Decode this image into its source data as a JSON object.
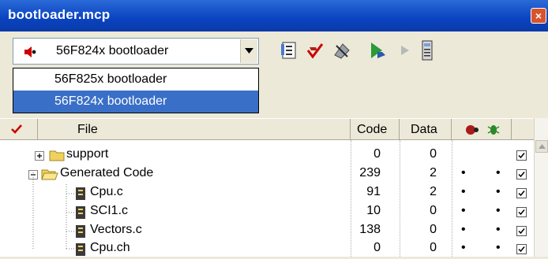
{
  "window": {
    "title": "bootloader.mcp",
    "close_glyph": "×"
  },
  "target": {
    "selected": "56F824x bootloader",
    "options": [
      "56F825x bootloader",
      "56F824x bootloader"
    ]
  },
  "toolbar_icons": [
    "settings-icon",
    "debug-check-icon",
    "make-icon",
    "debug-run-icon",
    "run-icon",
    "device-icon"
  ],
  "columns": [
    "File",
    "Code",
    "Data"
  ],
  "rows": [
    {
      "name": "support",
      "code": "0",
      "data": "0",
      "type": "folder",
      "expander": "+"
    },
    {
      "name": "Generated Code",
      "code": "239",
      "data": "2",
      "type": "folder-open",
      "expander": "−"
    },
    {
      "name": "Cpu.c",
      "code": "91",
      "data": "2",
      "type": "file"
    },
    {
      "name": "SCI1.c",
      "code": "10",
      "data": "0",
      "type": "file"
    },
    {
      "name": "Vectors.c",
      "code": "138",
      "data": "0",
      "type": "file"
    },
    {
      "name": "Cpu.ch",
      "code": "0",
      "data": "0",
      "type": "file"
    }
  ],
  "bullet": "•",
  "colors": {
    "title_bar": "#0a43c0",
    "selection": "#3a6fc8",
    "panel": "#ece9d8"
  }
}
